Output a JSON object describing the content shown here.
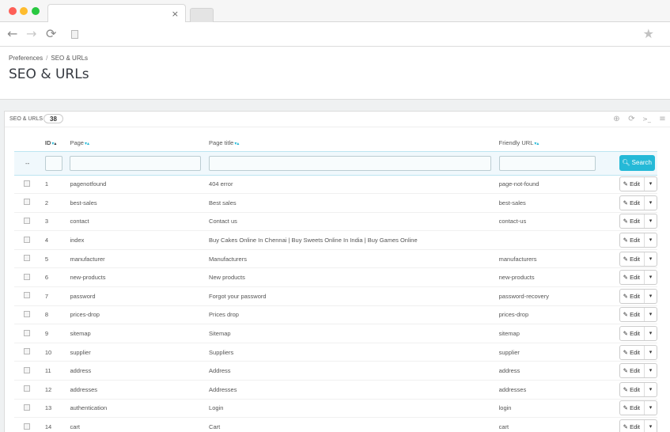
{
  "browser": {
    "tab_close": "×",
    "back": "←",
    "forward": "→",
    "reload": "⟳",
    "bookmark": "★"
  },
  "breadcrumb": {
    "parent": "Preferences",
    "sep": "/",
    "current": "SEO & URLs"
  },
  "page_title": "SEO & URLs",
  "panel": {
    "title": "SEO & URLs",
    "count": "38",
    "tools": {
      "add": "⊕",
      "refresh": "⟳",
      "sql": ">_",
      "export": "≡"
    }
  },
  "columns": {
    "id": "ID",
    "page": "Page",
    "page_title": "Page title",
    "friendly_url": "Friendly URL",
    "filter_dash": "--",
    "search_label": "Search"
  },
  "row_action": {
    "edit_label": "Edit",
    "edit_icon": "✎",
    "caret": "▾"
  },
  "rows": [
    {
      "id": "1",
      "page": "pagenotfound",
      "title": "404 error",
      "url": "page-not-found"
    },
    {
      "id": "2",
      "page": "best-sales",
      "title": "Best sales",
      "url": "best-sales"
    },
    {
      "id": "3",
      "page": "contact",
      "title": "Contact us",
      "url": "contact-us"
    },
    {
      "id": "4",
      "page": "index",
      "title": "Buy Cakes Online In Chennai | Buy Sweets Online In India | Buy Games Online",
      "url": ""
    },
    {
      "id": "5",
      "page": "manufacturer",
      "title": "Manufacturers",
      "url": "manufacturers"
    },
    {
      "id": "6",
      "page": "new-products",
      "title": "New products",
      "url": "new-products"
    },
    {
      "id": "7",
      "page": "password",
      "title": "Forgot your password",
      "url": "password-recovery"
    },
    {
      "id": "8",
      "page": "prices-drop",
      "title": "Prices drop",
      "url": "prices-drop"
    },
    {
      "id": "9",
      "page": "sitemap",
      "title": "Sitemap",
      "url": "sitemap"
    },
    {
      "id": "10",
      "page": "supplier",
      "title": "Suppliers",
      "url": "supplier"
    },
    {
      "id": "11",
      "page": "address",
      "title": "Address",
      "url": "address"
    },
    {
      "id": "12",
      "page": "addresses",
      "title": "Addresses",
      "url": "addresses"
    },
    {
      "id": "13",
      "page": "authentication",
      "title": "Login",
      "url": "login"
    },
    {
      "id": "14",
      "page": "cart",
      "title": "Cart",
      "url": "cart"
    }
  ],
  "colors": {
    "accent": "#25b9d7",
    "title": "#363a41",
    "filter_bg": "#f0f8fc"
  }
}
